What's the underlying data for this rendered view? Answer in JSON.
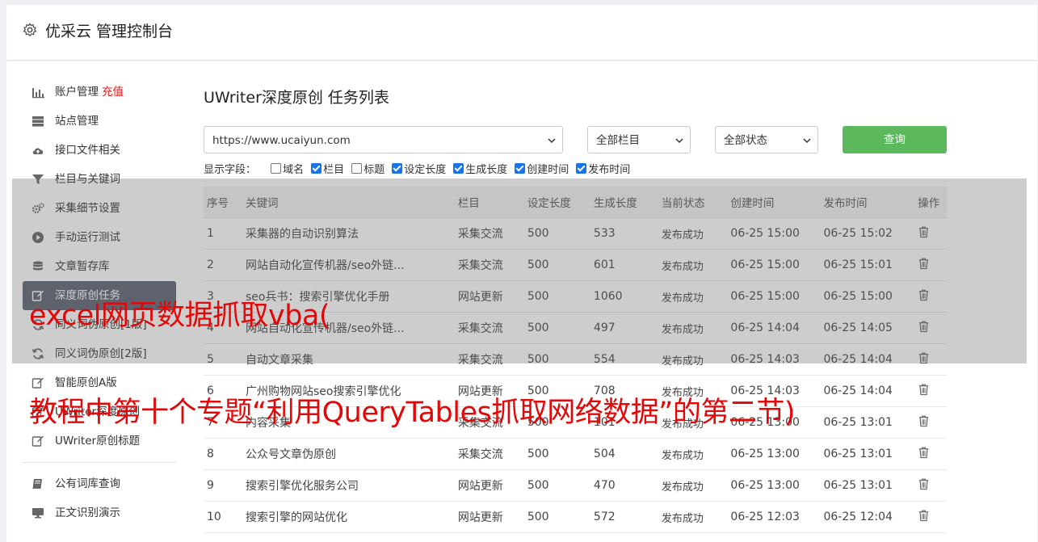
{
  "header": {
    "title": "优采云 管理控制台",
    "icon": "gear-icon"
  },
  "sidebar": {
    "items": [
      {
        "label": "账户管理",
        "badge": "充值",
        "icon": "bar-chart-icon"
      },
      {
        "label": "站点管理",
        "icon": "server-icon"
      },
      {
        "label": "接口文件相关",
        "icon": "cloud-upload-icon"
      },
      {
        "label": "栏目与关键词",
        "icon": "filter-icon"
      },
      {
        "label": "采集细节设置",
        "icon": "gears-icon"
      },
      {
        "label": "手动运行测试",
        "icon": "play-circle-icon"
      },
      {
        "label": "文章暂存库",
        "icon": "database-icon"
      },
      {
        "label": "深度原创任务",
        "icon": "edit-icon",
        "active": true
      },
      {
        "label": "同义词伪原创[1版]",
        "icon": "refresh-icon"
      },
      {
        "label": "同义词伪原创[2版]",
        "icon": "refresh-icon"
      },
      {
        "label": "智能原创A版",
        "icon": "edit-icon"
      },
      {
        "label": "UWriter深度原创",
        "icon": "edit-icon"
      },
      {
        "label": "UWriter原创标题",
        "icon": "edit-icon"
      }
    ],
    "items2": [
      {
        "label": "公有词库查询",
        "icon": "book-icon"
      },
      {
        "label": "正文识别演示",
        "icon": "monitor-icon"
      }
    ]
  },
  "main": {
    "title": "UWriter深度原创 任务列表",
    "site_select": "https://www.ucaiyun.com",
    "column_select": "全部栏目",
    "status_select": "全部状态",
    "query_button": "查询",
    "fields_label": "显示字段：",
    "fields": [
      {
        "label": "域名",
        "checked": false
      },
      {
        "label": "栏目",
        "checked": true
      },
      {
        "label": "标题",
        "checked": false
      },
      {
        "label": "设定长度",
        "checked": true
      },
      {
        "label": "生成长度",
        "checked": true
      },
      {
        "label": "创建时间",
        "checked": true
      },
      {
        "label": "发布时间",
        "checked": true
      }
    ],
    "table": {
      "headers": [
        "序号",
        "关键词",
        "栏目",
        "设定长度",
        "生成长度",
        "当前状态",
        "创建时间",
        "发布时间",
        "操作"
      ],
      "rows": [
        [
          "1",
          "采集器的自动识别算法",
          "采集交流",
          "500",
          "533",
          "发布成功",
          "06-25 15:00",
          "06-25 15:02"
        ],
        [
          "2",
          "网站自动化宣传机器/seo外链...",
          "采集交流",
          "500",
          "601",
          "发布成功",
          "06-25 15:00",
          "06-25 15:01"
        ],
        [
          "3",
          "seo兵书：搜索引擎优化手册",
          "网站更新",
          "500",
          "1060",
          "发布成功",
          "06-25 15:00",
          "06-25 15:00"
        ],
        [
          "4",
          "网站自动化宣传机器/seo外链...",
          "采集交流",
          "500",
          "497",
          "发布成功",
          "06-25 14:04",
          "06-25 14:05"
        ],
        [
          "5",
          "自动文章采集",
          "采集交流",
          "500",
          "554",
          "发布成功",
          "06-25 14:03",
          "06-25 14:04"
        ],
        [
          "6",
          "广州购物网站seo搜索引擎优化",
          "网站更新",
          "500",
          "708",
          "发布成功",
          "06-25 14:03",
          "06-25 14:04"
        ],
        [
          "7",
          "内容采集",
          "采集交流",
          "500",
          "101",
          "发布成功",
          "06-25 13:00",
          "06-25 13:01"
        ],
        [
          "8",
          "公众号文章伪原创",
          "采集交流",
          "500",
          "504",
          "发布成功",
          "06-25 13:00",
          "06-25 13:01"
        ],
        [
          "9",
          "搜索引擎优化服务公司",
          "网站更新",
          "500",
          "470",
          "发布成功",
          "06-25 13:00",
          "06-25 13:01"
        ],
        [
          "10",
          "搜索引擎的网站优化",
          "网站更新",
          "500",
          "572",
          "发布成功",
          "06-25 12:03",
          "06-25 12:04"
        ]
      ]
    }
  },
  "overlay": {
    "line1": "excel网页数据抓取vba(",
    "line2": "教程中第十个专题“利用QueryTables抓取网络数据”的第二节)"
  }
}
